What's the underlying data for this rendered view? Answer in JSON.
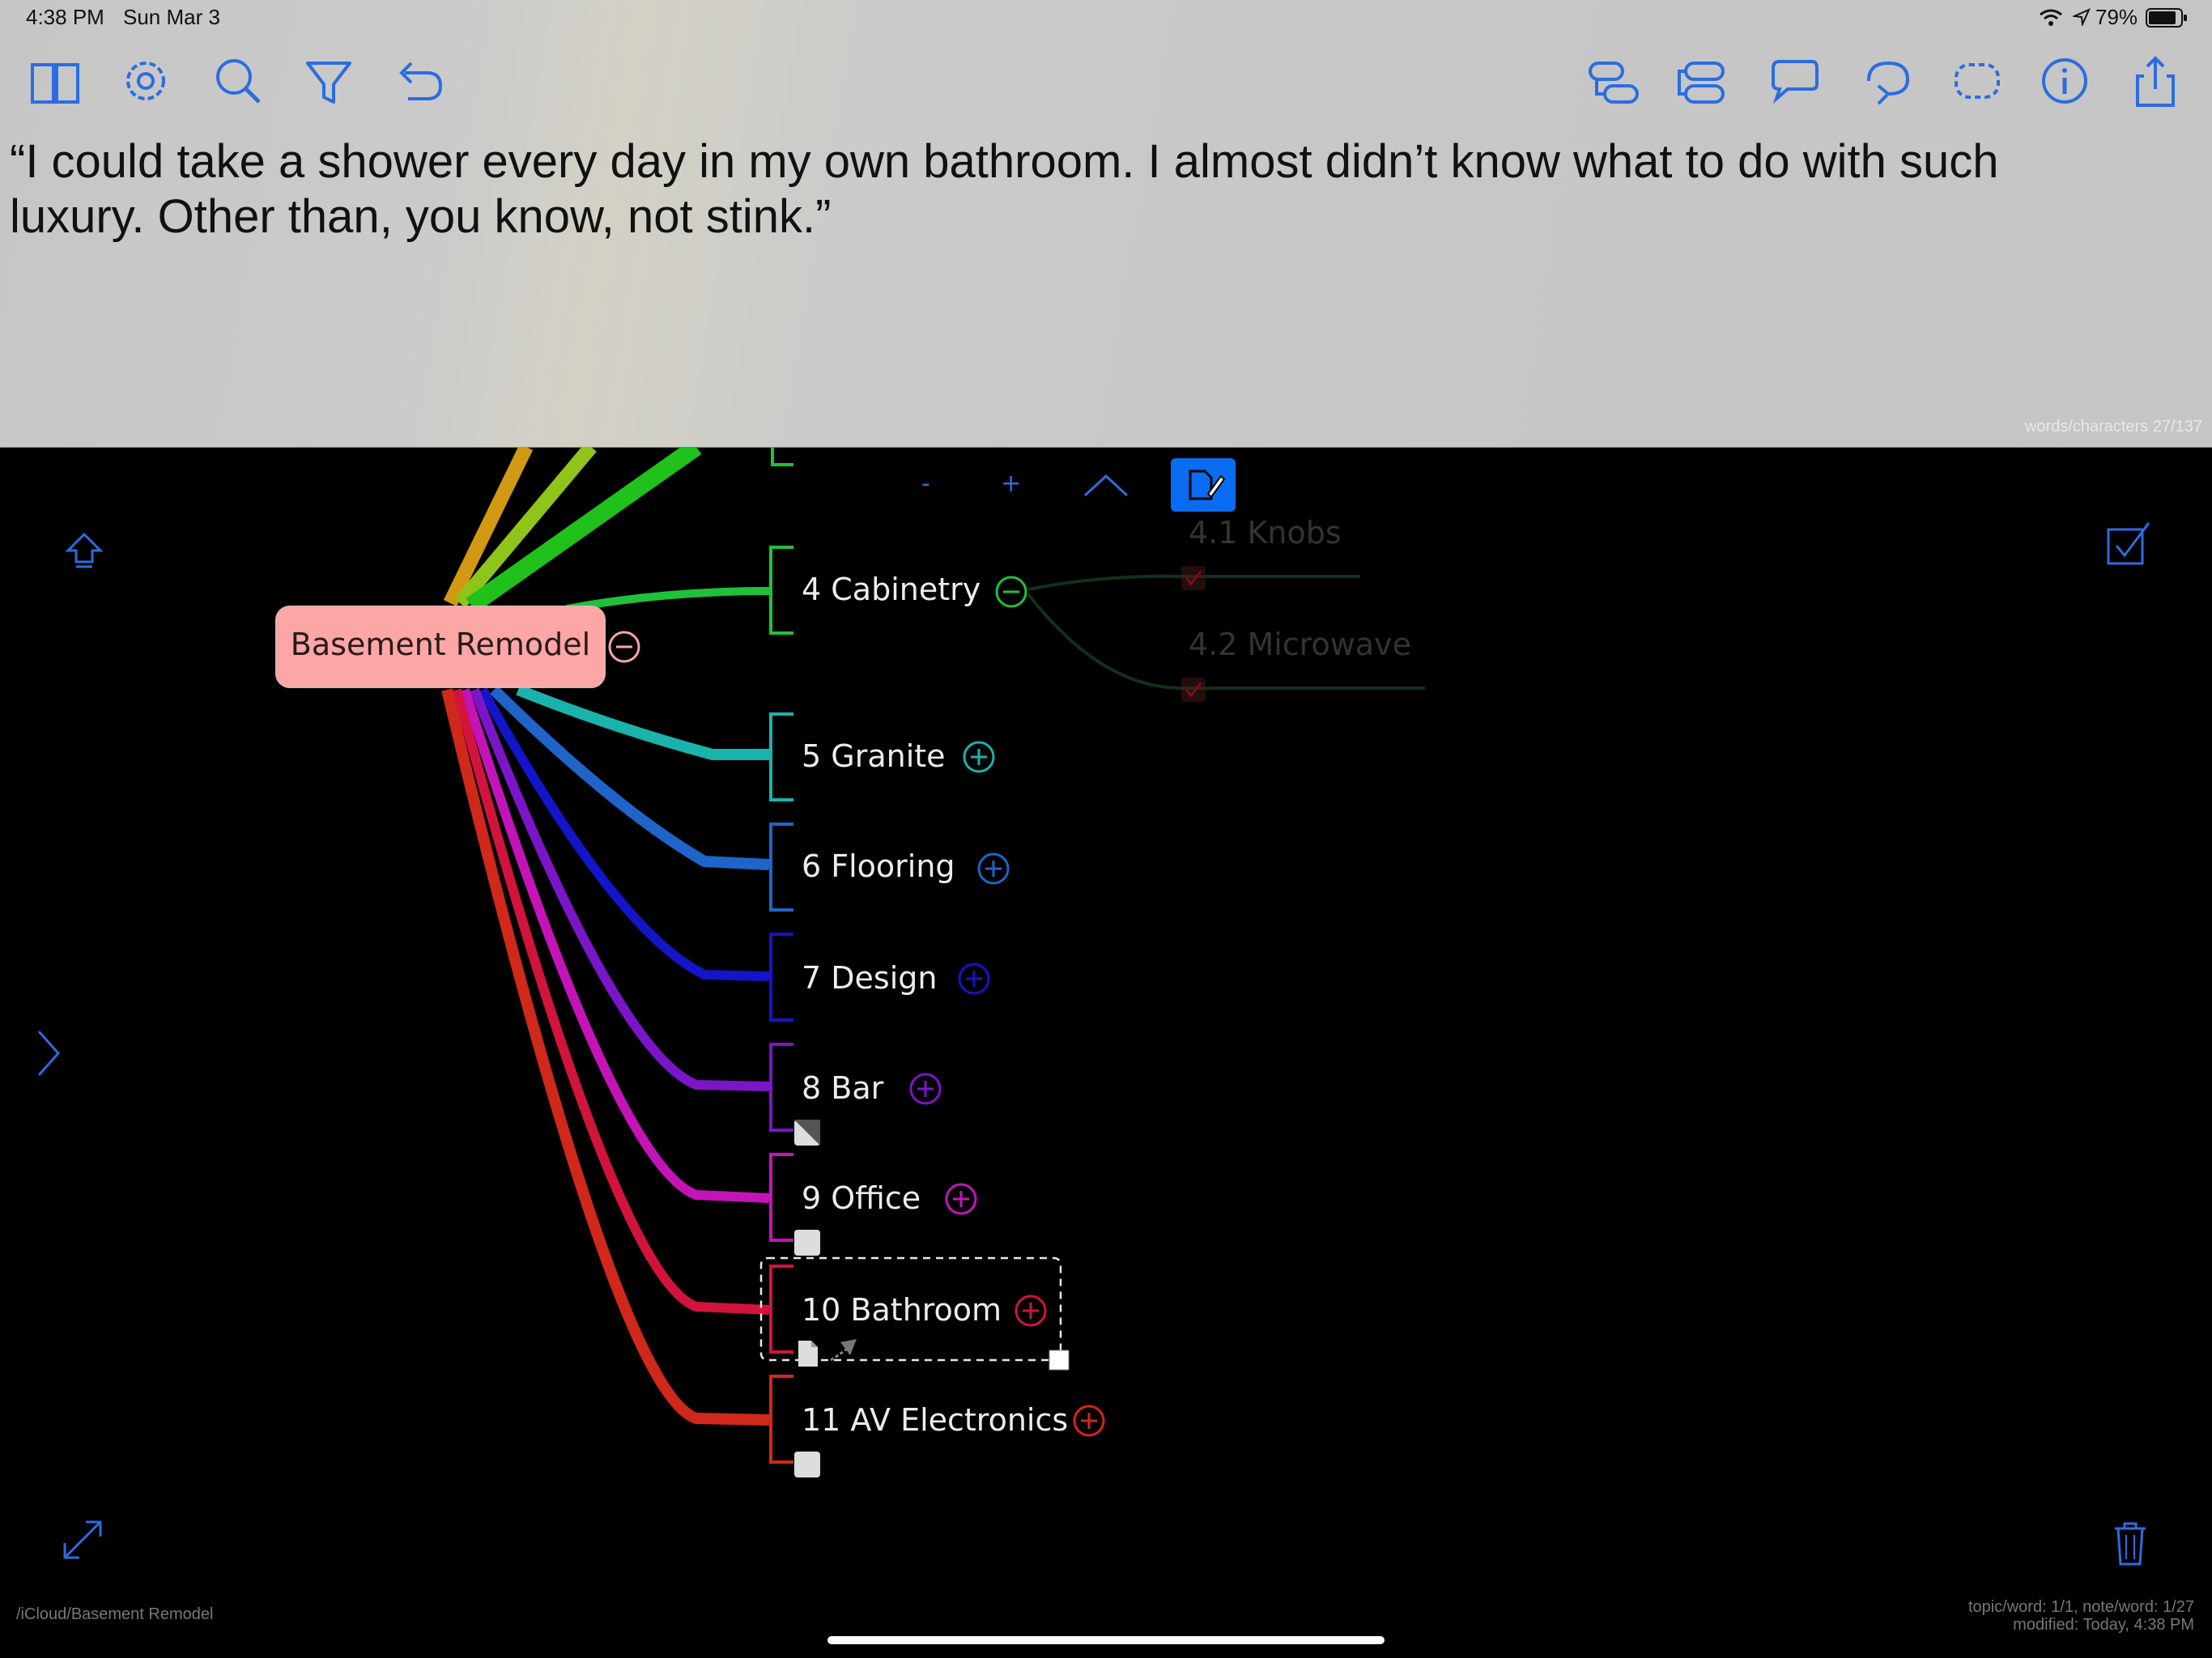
{
  "status_bar": {
    "time": "4:38 PM",
    "date": "Sun Mar 3",
    "battery": "79%"
  },
  "toolbar": {
    "left_icons": [
      "book-icon",
      "gear-icon",
      "search-icon",
      "filter-icon",
      "undo-icon"
    ],
    "right_icons": [
      "add-child-icon",
      "add-sibling-icon",
      "callout-icon",
      "relationship-icon",
      "boundary-icon",
      "info-icon",
      "share-icon"
    ]
  },
  "note": {
    "text": "“I could take a shower every day in my own bathroom. I almost didn’t know what to do with such luxury. Other than, you know, not stink.”",
    "word_count": "words/characters 27/137"
  },
  "mini_toolbar": {
    "minus": "-",
    "plus": "+"
  },
  "map": {
    "central_topic": "Basement Remodel",
    "topics": [
      {
        "label": "4 Cabinetry",
        "color": "#1fc13a",
        "state": "collapse"
      },
      {
        "label": "5 Granite",
        "color": "#1ab3ab",
        "state": "expand"
      },
      {
        "label": "6 Flooring",
        "color": "#1f64c8",
        "state": "expand"
      },
      {
        "label": "7 Design",
        "color": "#1414c8",
        "state": "expand"
      },
      {
        "label": "8 Bar",
        "color": "#7a16c8",
        "state": "expand"
      },
      {
        "label": "9 Office",
        "color": "#c414b8",
        "state": "expand"
      },
      {
        "label": "10 Bathroom",
        "color": "#d0143c",
        "state": "expand"
      },
      {
        "label": "11 AV Electronics",
        "color": "#d0281a",
        "state": "expand"
      }
    ],
    "subtopics": [
      "4.1 Knobs",
      "4.2 Microwave"
    ]
  },
  "footer": {
    "path": "/iCloud/Basement Remodel",
    "stats_line1": "topic/word: 1/1, note/word: 1/27",
    "stats_line2": "modified: Today, 4:38 PM"
  },
  "colors": {
    "accent": "#2b6de0",
    "central_fill": "#fca6a6"
  }
}
